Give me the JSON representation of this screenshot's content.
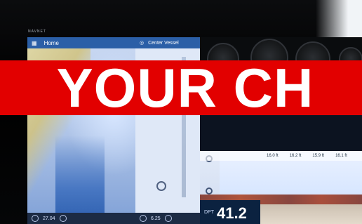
{
  "brand": {
    "label": "NAVNET"
  },
  "chart": {
    "home_label": "Home",
    "bottom_left_value": "27.04",
    "accent_bar_color": "#2b5fa7"
  },
  "mid": {
    "center_label": "Center Vessel",
    "bottom_value": "6.25"
  },
  "depth": {
    "label": "DPT",
    "value": "41.2"
  },
  "fishfinder": {
    "strip_values": [
      "16.0 ft",
      "16.2 ft",
      "15.9 ft",
      "16.1 ft"
    ]
  },
  "banner": {
    "text": "YOUR CH"
  },
  "colors": {
    "banner": "#e20000",
    "bezel": "#000000"
  }
}
